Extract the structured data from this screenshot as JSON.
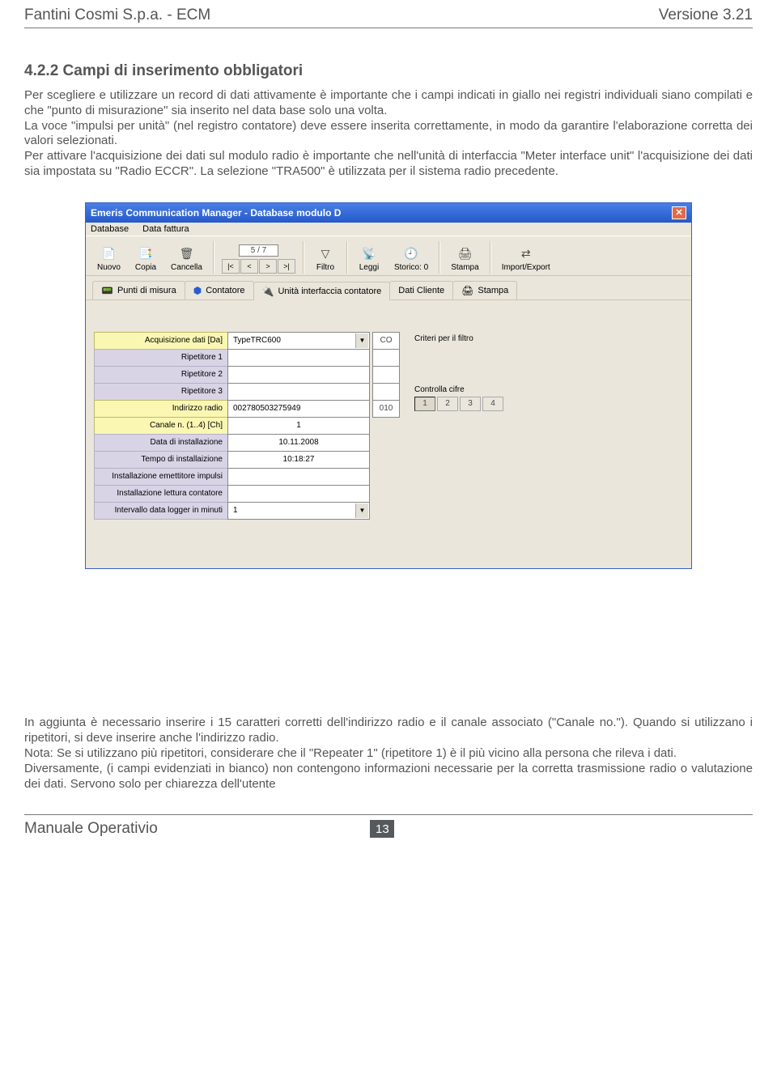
{
  "header": {
    "left": "Fantini Cosmi S.p.a. - ECM",
    "right": "Versione 3.21"
  },
  "section_title": "4.2.2 Campi di inserimento obbligatori",
  "para1": "Per scegliere e utilizzare un record di dati attivamente è importante che i campi indicati in giallo nei registri individuali siano compilati e che \"punto di misurazione\" sia inserito nel data base solo una volta.",
  "para2": "La voce \"impulsi per unità\" (nel registro contatore) deve essere inserita correttamente, in modo da garantire l'elaborazione corretta dei valori selezionati.",
  "para3": "Per attivare l'acquisizione dei dati sul modulo radio è importante che nell'unità di interfaccia \"Meter interface unit\" l'acquisizione dei dati sia impostata su \"Radio ECCR\". La selezione \"TRA500\" è utilizzata per il sistema radio precedente.",
  "app": {
    "title": "Emeris Communication Manager - Database modulo D",
    "menu": {
      "m1": "Database",
      "m2": "Data fattura"
    },
    "toolbar": {
      "nuovo": "Nuovo",
      "copia": "Copia",
      "cancella": "Cancella",
      "counter": "5 / 7",
      "filtro": "Filtro",
      "leggi": "Leggi",
      "storico": "Storico: 0",
      "stampa": "Stampa",
      "impexp": "Import/Export"
    },
    "tabs": {
      "t1": "Punti di misura",
      "t2": "Contatore",
      "t3": "Unità interfaccia contatore",
      "t4": "Dati Cliente",
      "t5": "Stampa"
    },
    "form": {
      "r1l": "Acquisizione dati  [Da]",
      "r1v": "TypeTRC600",
      "r1s": "CO",
      "r2l": "Ripetitore 1",
      "r3l": "Ripetitore 2",
      "r4l": "Ripetitore 3",
      "r5l": "Indirizzo radio",
      "r5v": "002780503275949",
      "r5s": "010",
      "r6l": "Canale n. (1..4)  [Ch]",
      "r6v": "1",
      "r7l": "Data di installazione",
      "r7v": "10.11.2008",
      "r8l": "Tempo di installaizione",
      "r8v": "10:18:27",
      "r9l": "Installazione emettitore impulsi",
      "r10l": "Installazione lettura contatore",
      "r11l": "Intervallo data logger in minuti",
      "r11v": "1"
    },
    "side": {
      "criteri": "Criteri per il filtro",
      "controlla": "Controlla cifre",
      "b1": "1",
      "b2": "2",
      "b3": "3",
      "b4": "4"
    }
  },
  "para4": "In aggiunta è necessario inserire i 15 caratteri corretti dell'indirizzo radio e il canale associato (\"Canale no.\"). Quando si utilizzano i ripetitori, si deve inserire anche l'indirizzo radio.",
  "para5": "Nota: Se si utilizzano più ripetitori, considerare che il \"Repeater 1\" (ripetitore 1) è il più vicino alla persona che rileva i dati.",
  "para6": "Diversamente, (i campi evidenziati in bianco) non contengono informazioni necessarie per la corretta trasmissione radio o valutazione dei dati. Servono solo per chiarezza dell'utente",
  "footer": {
    "label": "Manuale Operativio",
    "page": "13"
  }
}
